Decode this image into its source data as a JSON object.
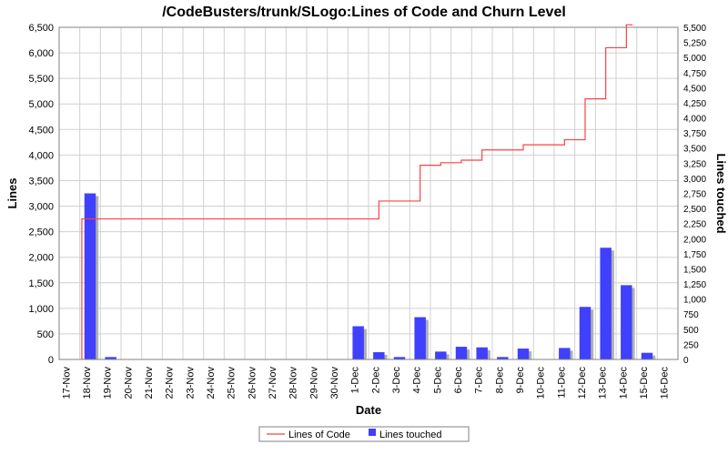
{
  "chart_data": {
    "type": "bar+line",
    "title": "/CodeBusters/trunk/SLogo:Lines of Code and Churn Level",
    "xlabel": "Date",
    "ylabel_left": "Lines",
    "ylabel_right": "Lines touched",
    "categories": [
      "17-Nov",
      "18-Nov",
      "19-Nov",
      "20-Nov",
      "21-Nov",
      "22-Nov",
      "23-Nov",
      "24-Nov",
      "25-Nov",
      "26-Nov",
      "27-Nov",
      "28-Nov",
      "29-Nov",
      "30-Nov",
      "1-Dec",
      "2-Dec",
      "3-Dec",
      "4-Dec",
      "5-Dec",
      "6-Dec",
      "7-Dec",
      "8-Dec",
      "9-Dec",
      "10-Dec",
      "11-Dec",
      "12-Dec",
      "13-Dec",
      "14-Dec",
      "15-Dec",
      "16-Dec"
    ],
    "left_axis": {
      "min": 0,
      "max": 6500,
      "step": 500
    },
    "right_axis": {
      "min": 0,
      "max": 5500,
      "step": 250
    },
    "series": [
      {
        "name": "Lines of Code",
        "type": "line",
        "axis": "left",
        "values": [
          null,
          2750,
          2750,
          2750,
          2750,
          2750,
          2750,
          2750,
          2750,
          2750,
          2750,
          2750,
          2750,
          2750,
          2750,
          3100,
          3100,
          3800,
          3850,
          3900,
          4100,
          4100,
          4200,
          4200,
          4300,
          5100,
          6100,
          6550,
          null,
          null
        ]
      },
      {
        "name": "Lines touched",
        "type": "bar",
        "axis": "right",
        "values": [
          0,
          2750,
          40,
          0,
          0,
          0,
          0,
          0,
          0,
          0,
          0,
          0,
          0,
          0,
          550,
          120,
          40,
          700,
          130,
          210,
          200,
          40,
          180,
          0,
          190,
          870,
          1850,
          1230,
          110,
          0
        ]
      }
    ],
    "legend": [
      "Lines of Code",
      "Lines touched"
    ]
  }
}
